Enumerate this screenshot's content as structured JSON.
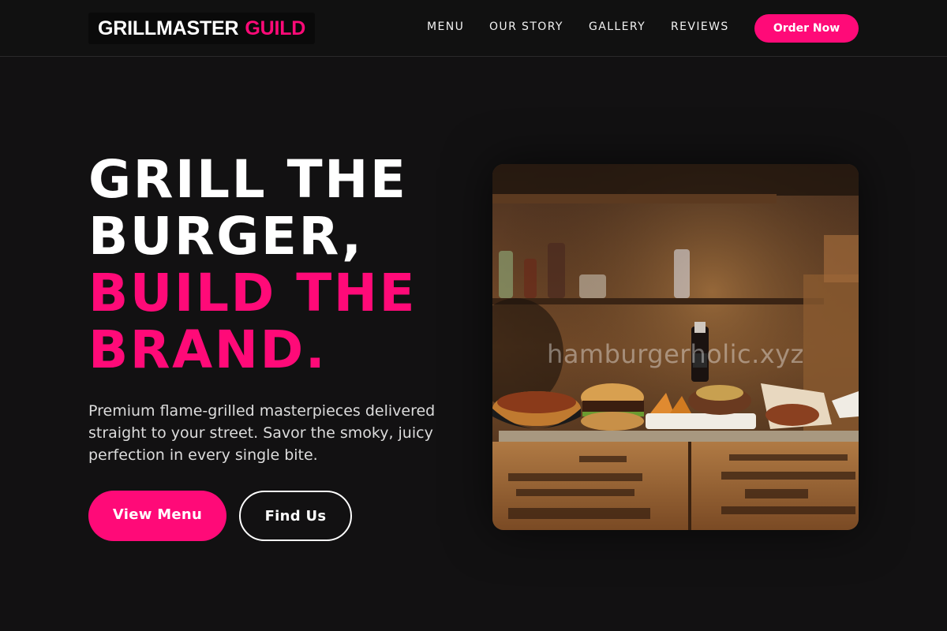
{
  "brand": {
    "name_part1": "GRILLMASTER",
    "name_part2": "GUILD"
  },
  "nav": {
    "items": [
      {
        "label": "MENU"
      },
      {
        "label": "OUR STORY"
      },
      {
        "label": "GALLERY"
      },
      {
        "label": "REVIEWS"
      }
    ],
    "cta_label": "Order Now"
  },
  "hero": {
    "headline_line1": "GRILL THE",
    "headline_line2": "BURGER,",
    "headline_line3": "BUILD THE",
    "headline_line4": "BRAND.",
    "description": "Premium flame-grilled masterpieces delivered straight to your street. Savor the smoky, juicy perfection in every single bite.",
    "primary_button": "View Menu",
    "secondary_button": "Find Us",
    "image_watermark": "hamburgerholic.xyz"
  },
  "colors": {
    "accent": "#ff0a78",
    "background": "#121112",
    "text": "#ffffff"
  }
}
